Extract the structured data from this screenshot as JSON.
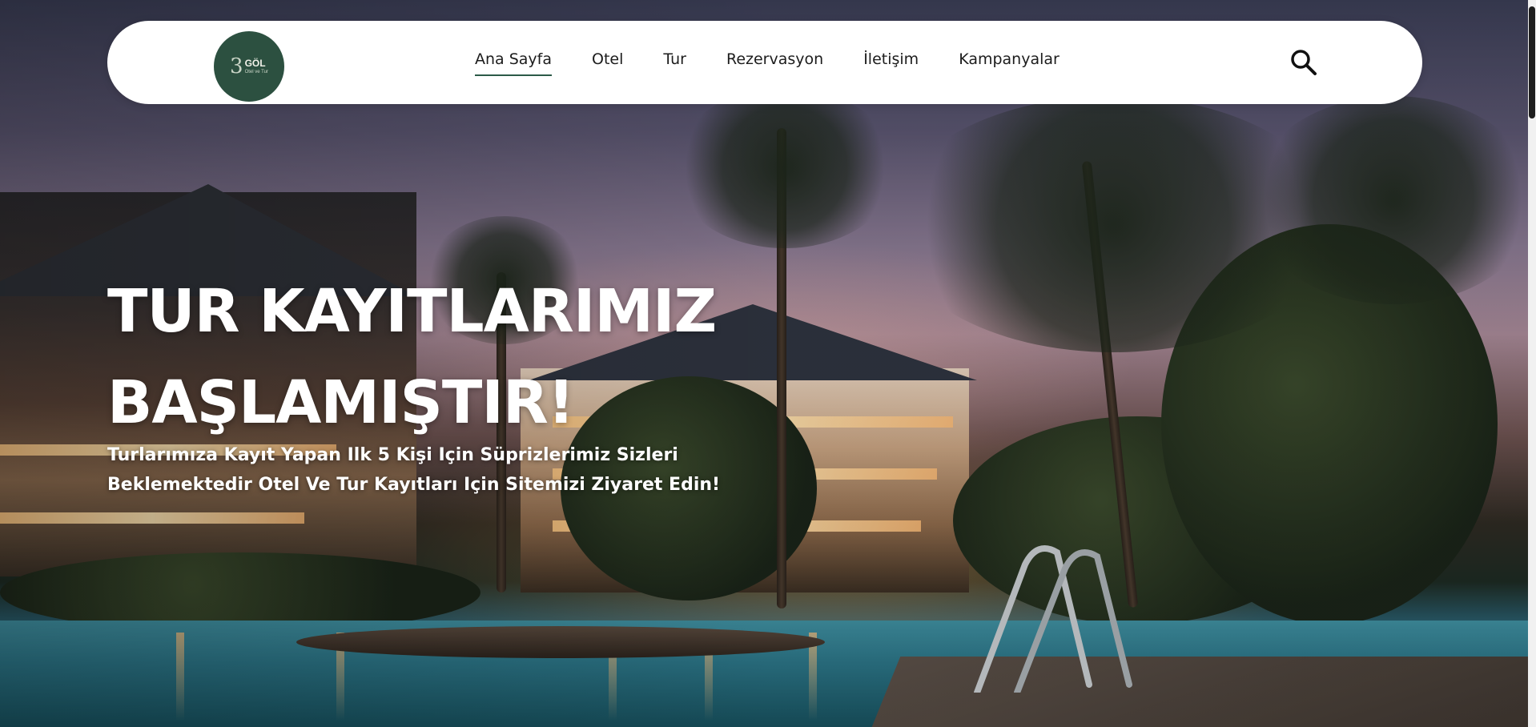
{
  "brand": {
    "logo_mark": "3",
    "logo_name": "GÖL",
    "logo_sub": "Otel ve Tur"
  },
  "nav": {
    "items": [
      {
        "label": "Ana Sayfa",
        "active": true
      },
      {
        "label": "Otel",
        "active": false
      },
      {
        "label": "Tur",
        "active": false
      },
      {
        "label": "Rezervasyon",
        "active": false
      },
      {
        "label": "İletişim",
        "active": false
      },
      {
        "label": "Kampanyalar",
        "active": false
      }
    ],
    "search_icon": "search-icon"
  },
  "hero": {
    "title_line1": "TUR KAYITLARIMIZ",
    "title_line2": "BAŞLAMIŞTIR!",
    "subtitle_line1": "Turlarımıza Kayıt Yapan Ilk 5 Kişi Için Süprizlerimiz Sizleri",
    "subtitle_line2": "Beklemektedir Otel Ve Tur Kayıtları Için Sitemizi Ziyaret Edin!"
  },
  "colors": {
    "brand_green": "#2c5040",
    "nav_underline": "#2c5a48",
    "navbar_bg": "#ffffff",
    "hero_text": "#ffffff"
  }
}
